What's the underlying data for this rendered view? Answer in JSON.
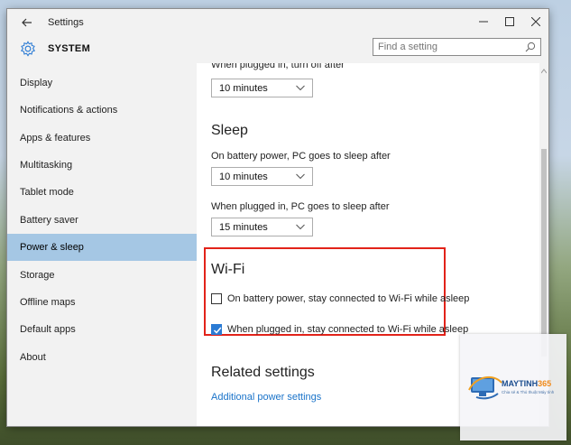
{
  "window": {
    "title": "Settings",
    "controls": [
      "minimize",
      "maximize",
      "close"
    ]
  },
  "header": {
    "section_title": "SYSTEM",
    "search_placeholder": "Find a setting"
  },
  "sidebar": {
    "items": [
      {
        "label": "Display"
      },
      {
        "label": "Notifications & actions"
      },
      {
        "label": "Apps & features"
      },
      {
        "label": "Multitasking"
      },
      {
        "label": "Tablet mode"
      },
      {
        "label": "Battery saver"
      },
      {
        "label": "Power & sleep",
        "active": true
      },
      {
        "label": "Storage"
      },
      {
        "label": "Offline maps"
      },
      {
        "label": "Default apps"
      },
      {
        "label": "About"
      }
    ]
  },
  "content": {
    "partial_top_label": "When plugged in, turn off after",
    "screen_plugged_value": "10 minutes",
    "sleep": {
      "heading": "Sleep",
      "battery_label": "On battery power, PC goes to sleep after",
      "battery_value": "10 minutes",
      "plugged_label": "When plugged in, PC goes to sleep after",
      "plugged_value": "15 minutes"
    },
    "wifi": {
      "heading": "Wi-Fi",
      "battery_checkbox_label": "On battery power, stay connected to Wi-Fi while asleep",
      "battery_checked": false,
      "plugged_checkbox_label": "When plugged in, stay connected to Wi-Fi while asleep",
      "plugged_checked": true
    },
    "related": {
      "heading": "Related settings",
      "link": "Additional power settings"
    }
  },
  "watermark": {
    "brand_main": "MAYTINH",
    "brand_num": "365",
    "tagline": "Chia sẻ & Thủ thuật Máy tính"
  },
  "colors": {
    "accent": "#2b7bd4",
    "active_nav": "#a5c7e4",
    "highlight_border": "#e2231a",
    "link": "#1a73c9"
  }
}
